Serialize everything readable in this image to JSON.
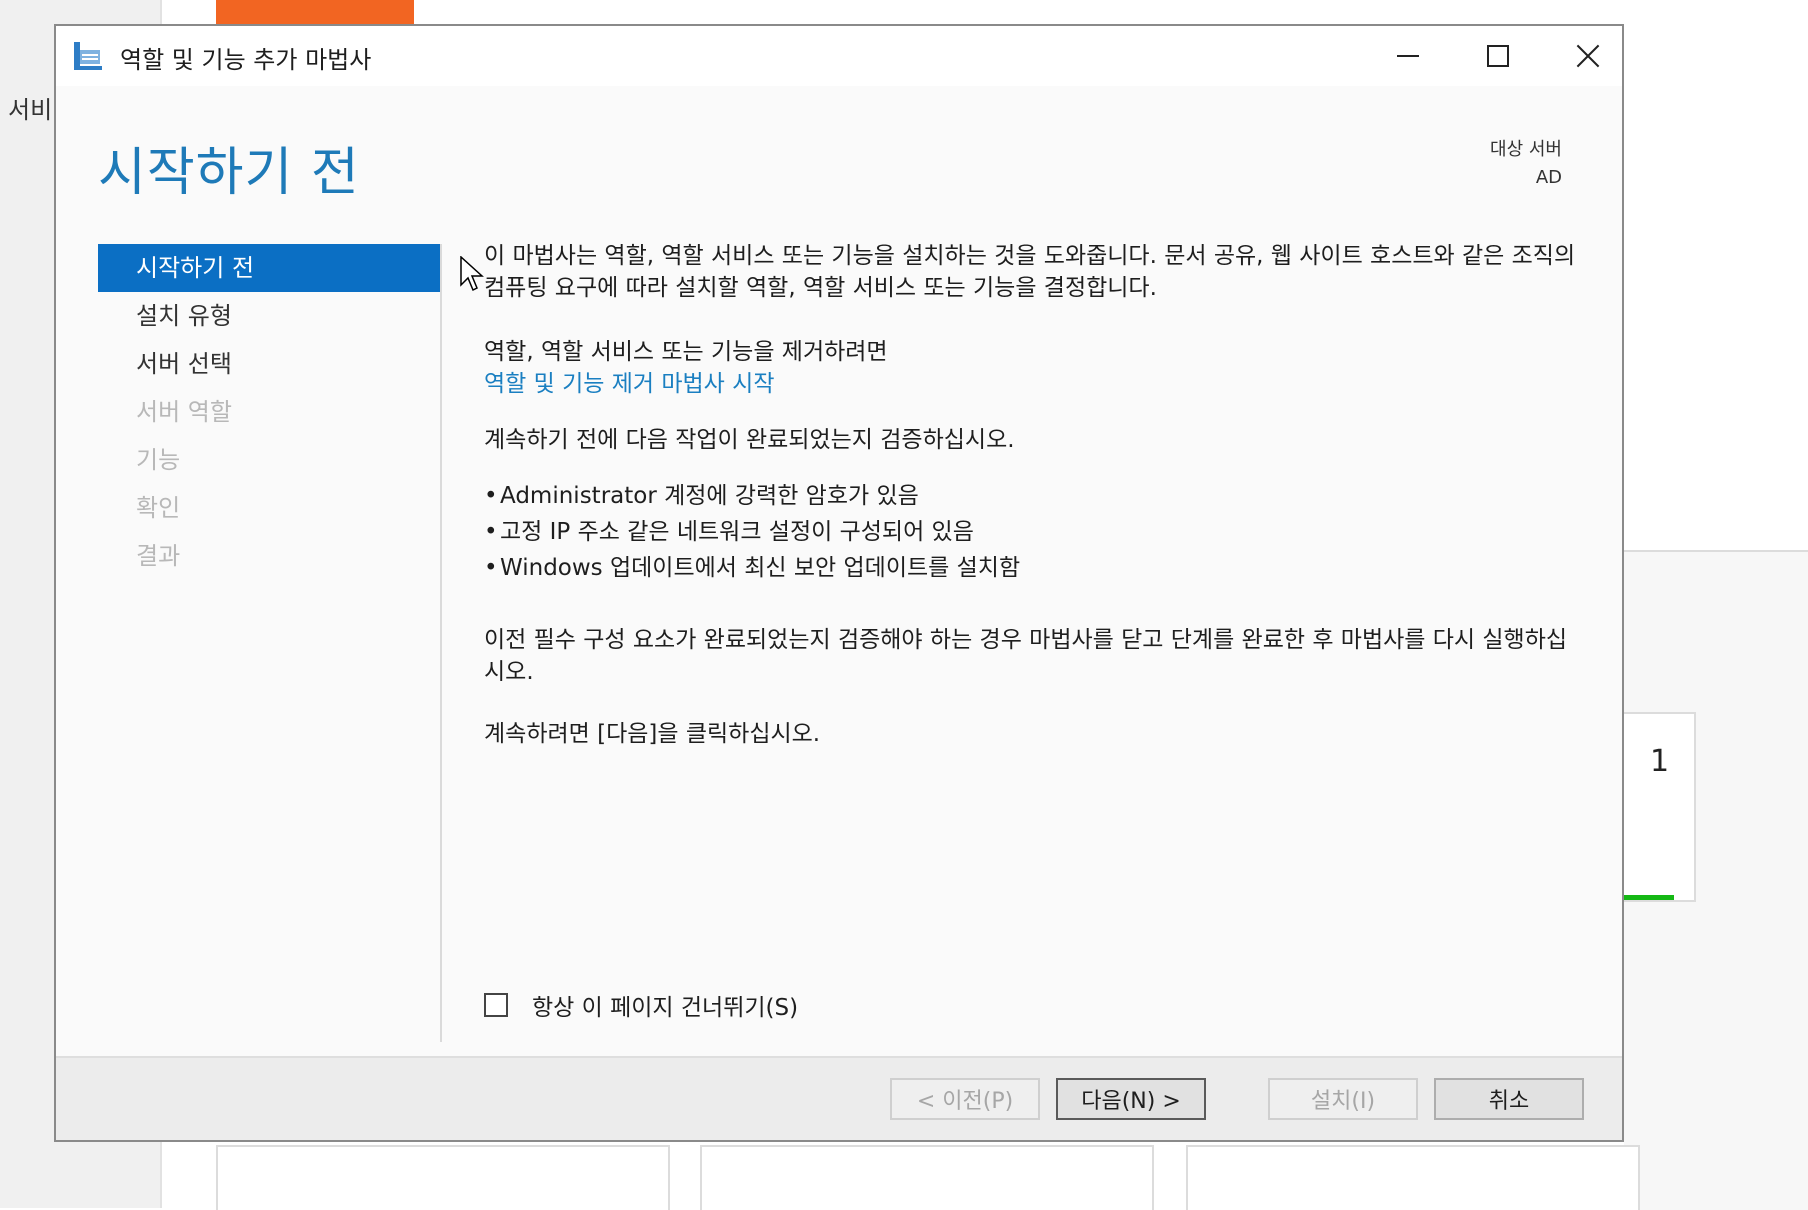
{
  "background": {
    "sidebar_text": "서비",
    "tile_number": "1"
  },
  "window": {
    "title": "역할 및 기능 추가 마법사",
    "icon": "wizard-icon",
    "controls": [
      "minimize-icon",
      "maximize-icon",
      "close-icon"
    ]
  },
  "header": {
    "page_title": "시작하기 전",
    "target_label": "대상 서버",
    "target_value": "AD"
  },
  "nav": {
    "items": [
      {
        "label": "시작하기 전",
        "state": "active"
      },
      {
        "label": "설치 유형",
        "state": "enabled"
      },
      {
        "label": "서버 선택",
        "state": "enabled"
      },
      {
        "label": "서버 역할",
        "state": "disabled"
      },
      {
        "label": "기능",
        "state": "disabled"
      },
      {
        "label": "확인",
        "state": "disabled"
      },
      {
        "label": "결과",
        "state": "disabled"
      }
    ]
  },
  "content": {
    "intro": "이 마법사는 역할, 역할 서비스 또는 기능을 설치하는 것을 도와줍니다. 문서 공유, 웹 사이트 호스트와 같은 조직의 컴퓨팅 요구에 따라 설치할 역할, 역할 서비스 또는 기능을 결정합니다.",
    "remove_label": "역할, 역할 서비스 또는 기능을 제거하려면",
    "remove_link": "역할 및 기능 제거 마법사 시작",
    "verify": "계속하기 전에 다음 작업이 완료되었는지 검증하십시오.",
    "bullets": [
      "Administrator 계정에 강력한 암호가 있음",
      "고정 IP 주소 같은 네트워크 설정이 구성되어 있음",
      "Windows 업데이트에서 최신 보안 업데이트를 설치함"
    ],
    "prereq": "이전 필수 구성 요소가 완료되었는지 검증해야 하는 경우 마법사를 닫고 단계를 완료한 후 마법사를 다시 실행하십시오.",
    "next_hint": "계속하려면 [다음]을 클릭하십시오."
  },
  "skip_checkbox": {
    "label": "항상 이 페이지 건너뛰기(S)",
    "checked": false
  },
  "footer": {
    "prev": "< 이전(P)",
    "next": "다음(N) >",
    "install": "설치(I)",
    "cancel": "취소"
  },
  "colors": {
    "accent": "#0b6fc4",
    "title": "#1e7ab8",
    "link": "#1a7fc1",
    "orange_tab": "#f26522",
    "status_green": "#14b814"
  }
}
